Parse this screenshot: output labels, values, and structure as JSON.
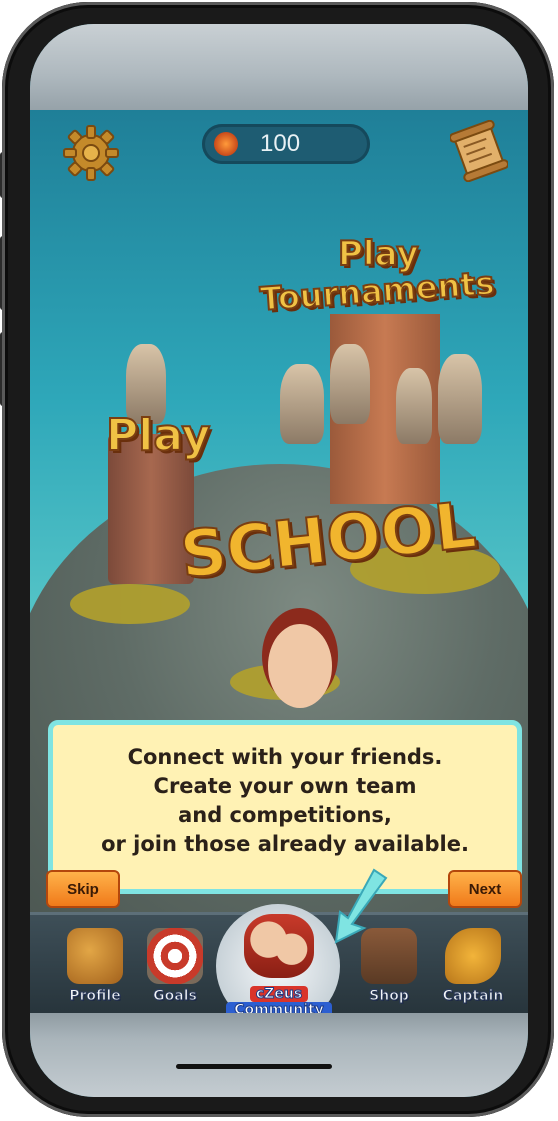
{
  "hud": {
    "coins": "100"
  },
  "world": {
    "play_label": "Play",
    "tournaments_label_line1": "Play",
    "tournaments_label_line2": "Tournaments",
    "school_label": "SCHOOL"
  },
  "tutorial": {
    "lines": [
      "Connect with your friends.",
      "Create your own team",
      "and competitions,",
      "or join those already available."
    ],
    "skip_label": "Skip",
    "next_label": "Next"
  },
  "nav": {
    "items": [
      {
        "label": "Profile"
      },
      {
        "label": "Goals"
      },
      {
        "label_line1": "cZeus",
        "label_line2": "Community"
      },
      {
        "label": "Shop"
      },
      {
        "label": "Captain"
      }
    ]
  },
  "colors": {
    "accent_orange": "#f07a1a",
    "tooltip_bg": "#fff2b4",
    "tooltip_border": "#7fe4e2",
    "title_gold": "#f0c245"
  },
  "icons": {
    "settings": "gear-icon",
    "map": "scroll-map-icon",
    "currency": "coin-icon",
    "pointer": "arrow-pointer-icon"
  }
}
